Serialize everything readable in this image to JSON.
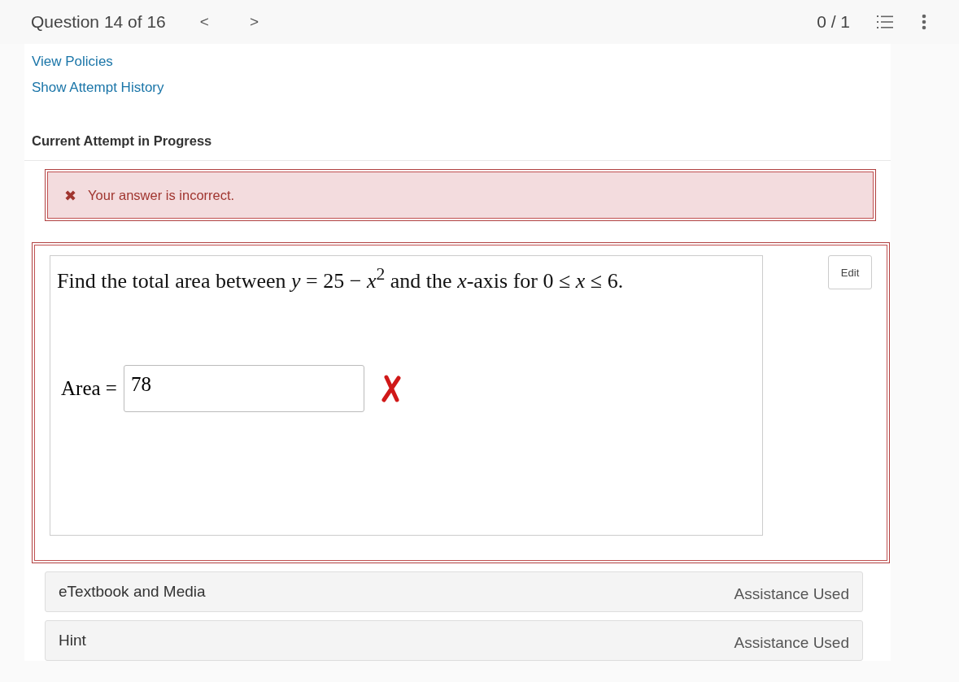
{
  "header": {
    "title": "Question 14 of 16",
    "prev": "<",
    "next": ">",
    "score": "0 / 1"
  },
  "links": [
    "View Policies",
    "Show Attempt History"
  ],
  "attempt_heading": "Current Attempt in Progress",
  "alert": {
    "kind": "error",
    "icon": "✖",
    "message": "Your answer is incorrect."
  },
  "question": {
    "text": "Find the total area between *y* = 25 − *x*$^{2}$ and the *x*-axis for 0 ≤ *x* ≤ 6.",
    "edit": "Edit",
    "answer": {
      "label": "Area =",
      "value": "78",
      "correct": false
    }
  },
  "assistance": [
    {
      "title": "eTextbook and Media",
      "status": "Assistance Used"
    },
    {
      "title": "Hint",
      "status": "Assistance Used"
    }
  ]
}
